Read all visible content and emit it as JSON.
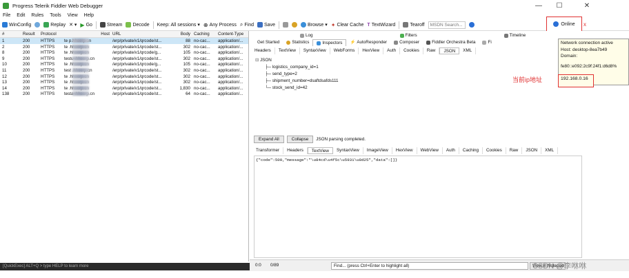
{
  "window": {
    "title": "Progress Telerik Fiddler Web Debugger",
    "minimize": "—",
    "maximize": "☐",
    "close": "✕"
  },
  "menu": [
    "File",
    "Edit",
    "Rules",
    "Tools",
    "View",
    "Help"
  ],
  "toolbar": {
    "winconfig": "WinConfig",
    "replay": "Replay",
    "remove": "✕ ▾",
    "go": "Go",
    "stream": "Stream",
    "decode": "Decode",
    "keep": "Keep: All sessions ▾",
    "any_process": "Any Process",
    "find": "Find",
    "save": "Save",
    "browse": "Browse ▾",
    "clear_cache": "Clear Cache",
    "textwizard": "TextWizard",
    "tearoff": "Tearoff",
    "msdn_placeholder": "MSDN Search...",
    "online": "Online",
    "close_online": "x"
  },
  "sessions": {
    "headers": {
      "num": "#",
      "result": "Result",
      "protocol": "Protocol",
      "host": "Host",
      "url": "URL",
      "body": "Body",
      "caching": "Caching",
      "content_type": "Content-Type"
    },
    "rows": [
      {
        "num": "1",
        "result": "200",
        "protocol": "HTTPS",
        "host": "te    p.hhserp.cn",
        "url": "/erp/private/v1/qrcode/st...",
        "body": "88",
        "caching": "no-cac...",
        "content_type": "application/..."
      },
      {
        "num": "2",
        "result": "200",
        "protocol": "HTTPS",
        "host": "te    .hhserp.cn",
        "url": "/erp/private/v1/qrcode/st...",
        "body": "302",
        "caching": "no-cac...",
        "content_type": "application/..."
      },
      {
        "num": "8",
        "result": "200",
        "protocol": "HTTPS",
        "host": "te    .hhserp.cn",
        "url": "/erp/private/v1/qrcode/g...",
        "body": "105",
        "caching": "no-cac...",
        "content_type": "application/..."
      },
      {
        "num": "9",
        "result": "200",
        "protocol": "HTTPS",
        "host": "testu    .hhserp.cn",
        "url": "/erp/private/v1/qrcode/st...",
        "body": "302",
        "caching": "no-cac...",
        "content_type": "application/..."
      },
      {
        "num": "10",
        "result": "200",
        "protocol": "HTTPS",
        "host": "te    .hhserp.cn",
        "url": "/erp/private/v1/qrcode/g...",
        "body": "105",
        "caching": "no-cac...",
        "content_type": "application/..."
      },
      {
        "num": "11",
        "result": "200",
        "protocol": "HTTPS",
        "host": "test    .hhserp.cn",
        "url": "/erp/private/v1/qrcode/st...",
        "body": "302",
        "caching": "no-cac...",
        "content_type": "application/..."
      },
      {
        "num": "12",
        "result": "200",
        "protocol": "HTTPS",
        "host": "te    .hhserp.cn",
        "url": "/erp/private/v1/qrcode/st...",
        "body": "302",
        "caching": "no-cac...",
        "content_type": "application/..."
      },
      {
        "num": "13",
        "result": "200",
        "protocol": "HTTPS",
        "host": "te    .hhserp.cn",
        "url": "/erp/private/v1/qrcode/st...",
        "body": "302",
        "caching": "no-cac...",
        "content_type": "application/..."
      },
      {
        "num": "14",
        "result": "200",
        "protocol": "HTTPS",
        "host": "te    .hhserp.cn",
        "url": "/erp/private/v1/qrcode/st...",
        "body": "1,830",
        "caching": "no-cac...",
        "content_type": "application/..."
      },
      {
        "num": "138",
        "result": "200",
        "protocol": "HTTPS",
        "host": "testa    .hhserp.cn",
        "url": "/erp/private/v1/qrcode/st...",
        "body": "64",
        "caching": "no-cac...",
        "content_type": "application/..."
      }
    ]
  },
  "quickexec": "[QuickExec] ALT+Q > type HELP to learn more",
  "inspector": {
    "top_tabs_row1": {
      "log": "Log",
      "filters": "Filters",
      "timeline": "Timeline"
    },
    "top_tabs_row2": {
      "get_started": "Get Started",
      "statistics": "Statistics",
      "inspectors": "Inspectors",
      "autoresponder": "AutoResponder",
      "composer": "Composer",
      "orchestra": "Fiddler Orchestra Beta",
      "fiddlerscript": "Fi"
    },
    "request_tabs": [
      "Headers",
      "TextView",
      "SyntaxView",
      "WebForms",
      "HexView",
      "Auth",
      "Cookies",
      "Raw",
      "JSON",
      "XML"
    ],
    "json_tree": {
      "root": "JSON",
      "items": [
        "logistics_company_id=1",
        "send_type=2",
        "shipment_number=dsaftdsafds111",
        "stock_send_id=42"
      ]
    },
    "expand_all": "Expand All",
    "collapse": "Collapse",
    "parse_status": "JSON parsing completed.",
    "response_tabs": [
      "Transformer",
      "Headers",
      "TextView",
      "SyntaxView",
      "ImageView",
      "HexView",
      "WebView",
      "Auth",
      "Caching",
      "Cookies",
      "Raw",
      "JSON",
      "XML"
    ],
    "response_body": "{\"code\":500,\"message\":\"\\u84cd\\u4f5c\\u5931\\u8d25\",\"data\":[]}",
    "status_left": "0:0",
    "status_count": "0/89",
    "find_placeholder": "Find... (press Ctrl+Enter to highlight all)",
    "view_notepad": "View in Notepad"
  },
  "tooltip": {
    "line1": "Network connection active",
    "line2": "Host: desktop-8ea7b49",
    "line3": "Domain:",
    "line4": "fe80::e092:2c9f:24f1:d6d8%",
    "ip": "192.168.0.16"
  },
  "annotation": {
    "ip_label": "当前ip地址"
  },
  "watermark": "CSDN @李咻咻",
  "colors": {
    "red_highlight": "#e03030",
    "selection": "#cde6f7"
  }
}
